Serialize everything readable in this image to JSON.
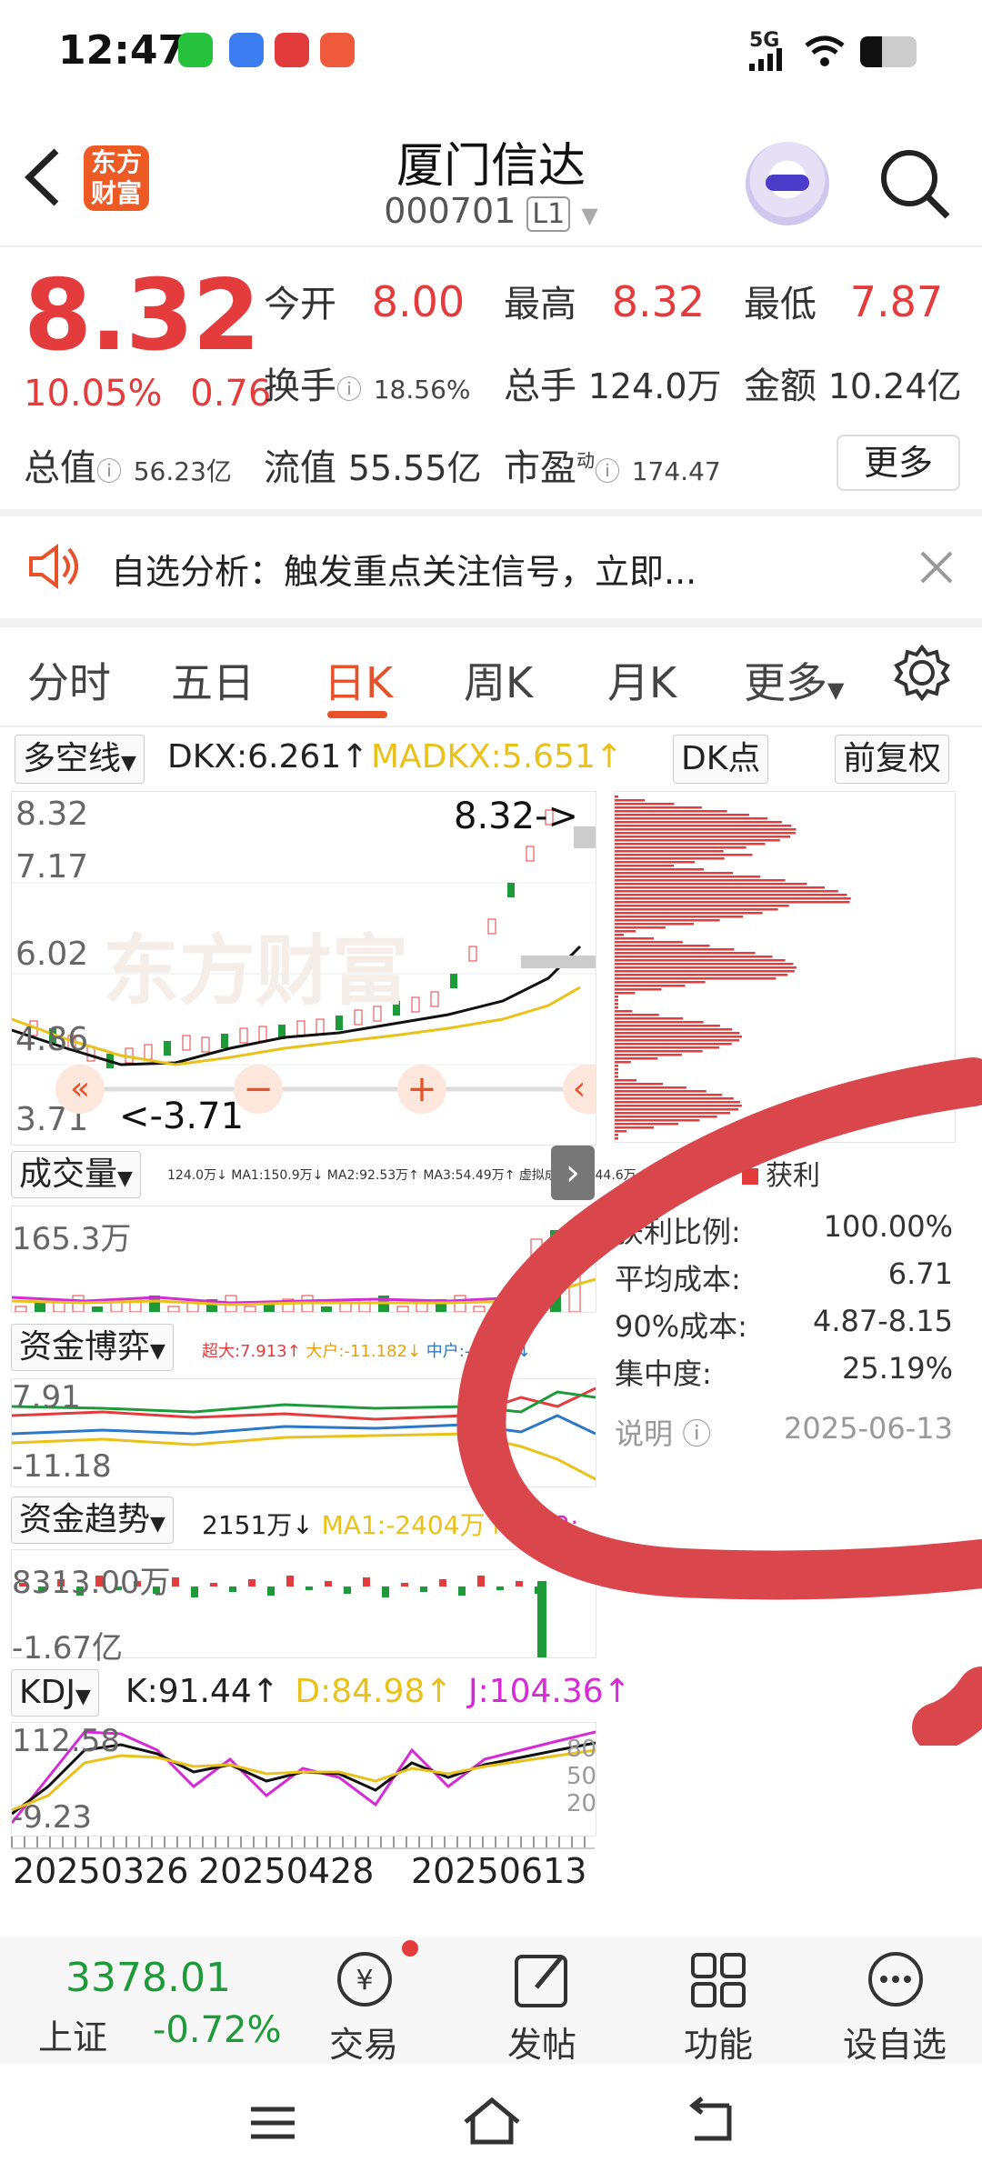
{
  "status_bar": {
    "time": "12:47",
    "network": "5G"
  },
  "header": {
    "back_icon": "chevron-left-icon",
    "brand_logo_text": "东方财富",
    "title": "厦门信达",
    "code": "000701",
    "level": "L1"
  },
  "quote": {
    "price": "8.32",
    "change_pct": "10.05%",
    "change": "0.76",
    "open_label": "今开",
    "open": "8.00",
    "high_label": "最高",
    "high": "8.32",
    "low_label": "最低",
    "low": "7.87",
    "turnover_label": "换手",
    "turnover": "18.56%",
    "volume_label": "总手",
    "volume": "124.0万",
    "amount_label": "金额",
    "amount": "10.24亿",
    "mktcap_label": "总值",
    "mktcap": "56.23亿",
    "float_label": "流值",
    "float": "55.55亿",
    "pe_label": "市盈",
    "pe_sup": "动",
    "pe": "174.47",
    "more": "更多"
  },
  "notice": {
    "text": "自选分析：触发重点关注信号，立即..."
  },
  "tabs": [
    "分时",
    "五日",
    "日K",
    "周K",
    "月K",
    "更多"
  ],
  "active_tab": "日K",
  "kline": {
    "indicator": "多空线",
    "dkx": "DKX:6.261↑",
    "madkx": "MADKX:5.651↑",
    "dk_btn": "DK点",
    "adjust": "前复权",
    "y_top": "8.32",
    "y2": "7.17",
    "y3": "6.02",
    "y4": "4.86",
    "y_bottom": "3.71",
    "hi_marker": "8.32->",
    "lo_marker": "<-3.71",
    "watermark": "东方财富"
  },
  "volume": {
    "label": "成交量",
    "legend": "124.0万↓ MA1:150.9万↓ MA2:92.53万↑ MA3:54.49万↑ 虚拟成交量:144.6万",
    "y_top": "165.3万"
  },
  "capital_game": {
    "label": "资金博弈",
    "legend_a": "超大:7.913↑",
    "legend_b": "大户:-11.182↓",
    "legend_c": "中户:-2.959↓",
    "y_top": "7.91",
    "y_bottom": "-11.18"
  },
  "capital_trend": {
    "label": "资金趋势",
    "legend_a": "2151万↓",
    "legend_b": "MA1:-2404万↑",
    "legend_c": "MA2:",
    "y_top": "8313.00万",
    "y_bottom": "-1.67亿"
  },
  "kdj": {
    "label": "KDJ",
    "k": "K:91.44↑",
    "d": "D:84.98↑",
    "j": "J:104.36↑",
    "y_top": "112.58",
    "y_bottom": "-9.23",
    "r80": "80",
    "r50": "50",
    "r20": "20"
  },
  "dates": {
    "d1": "20250326",
    "d2": "20250428",
    "d3": "20250613"
  },
  "chip": {
    "legend": "获利",
    "rows": [
      {
        "k": "获利比例:",
        "v": "100.00%"
      },
      {
        "k": "平均成本:",
        "v": "6.71"
      },
      {
        "k": "90%成本:",
        "v": "4.87-8.15"
      },
      {
        "k": "集中度:",
        "v": "25.19%"
      }
    ],
    "explain": "说明",
    "date": "2025-06-13"
  },
  "bottom_nav": {
    "index_value": "3378.01",
    "index_name": "上证",
    "index_change": "-0.72%",
    "items": [
      "交易",
      "发帖",
      "功能",
      "设自选"
    ]
  },
  "colors": {
    "red": "#e43c3c",
    "green": "#1f9a3a",
    "accent": "#e8522a",
    "yellow": "#e8c21a",
    "magenta": "#d42bd4"
  }
}
